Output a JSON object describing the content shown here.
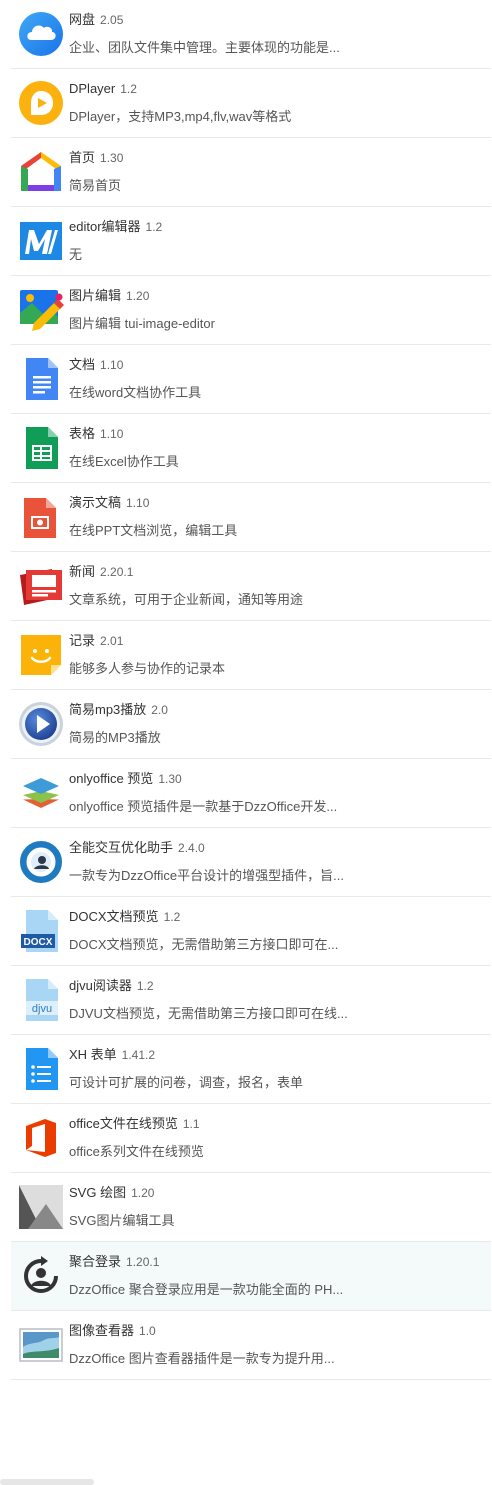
{
  "apps": [
    {
      "name": "网盘",
      "version": "2.05",
      "desc": "企业、团队文件集中管理。主要体现的功能是...",
      "icon": "cloud-icon"
    },
    {
      "name": "DPlayer",
      "version": "1.2",
      "desc": "DPlayer，支持MP3,mp4,flv,wav等格式",
      "icon": "dplayer-icon"
    },
    {
      "name": "首页",
      "version": "1.30",
      "desc": "简易首页",
      "icon": "home-icon"
    },
    {
      "name": "editor编辑器",
      "version": "1.2",
      "desc": "无",
      "icon": "editor-icon"
    },
    {
      "name": "图片编辑",
      "version": "1.20",
      "desc": "图片编辑 tui-image-editor",
      "icon": "image-edit-icon"
    },
    {
      "name": "文档",
      "version": "1.10",
      "desc": "在线word文档协作工具",
      "icon": "document-icon"
    },
    {
      "name": "表格",
      "version": "1.10",
      "desc": "在线Excel协作工具",
      "icon": "spreadsheet-icon"
    },
    {
      "name": "演示文稿",
      "version": "1.10",
      "desc": "在线PPT文档浏览，编辑工具",
      "icon": "presentation-icon"
    },
    {
      "name": "新闻",
      "version": "2.20.1",
      "desc": "文章系统，可用于企业新闻，通知等用途",
      "icon": "news-icon"
    },
    {
      "name": "记录",
      "version": "2.01",
      "desc": "能够多人参与协作的记录本",
      "icon": "notes-icon"
    },
    {
      "name": "简易mp3播放",
      "version": "2.0",
      "desc": "简易的MP3播放",
      "icon": "play-icon"
    },
    {
      "name": "onlyoffice 预览",
      "version": "1.30",
      "desc": "onlyoffice 预览插件是一款基于DzzOffice开发...",
      "icon": "onlyoffice-icon"
    },
    {
      "name": "全能交互优化助手",
      "version": "2.4.0",
      "desc": "一款专为DzzOffice平台设计的增强型插件，旨...",
      "icon": "assistant-icon"
    },
    {
      "name": "DOCX文档预览",
      "version": "1.2",
      "desc": "DOCX文档预览，无需借助第三方接口即可在...",
      "icon": "docx-icon",
      "icon_text": "DOCX"
    },
    {
      "name": "djvu阅读器",
      "version": "1.2",
      "desc": "DJVU文档预览，无需借助第三方接口即可在线...",
      "icon": "djvu-icon",
      "icon_text": "djvu"
    },
    {
      "name": "XH 表单",
      "version": "1.41.2",
      "desc": "可设计可扩展的问卷，调查，报名，表单",
      "icon": "form-icon"
    },
    {
      "name": "office文件在线预览",
      "version": "1.1",
      "desc": "office系列文件在线预览",
      "icon": "office-icon"
    },
    {
      "name": "SVG 绘图",
      "version": "1.20",
      "desc": "SVG图片编辑工具",
      "icon": "svg-draw-icon"
    },
    {
      "name": "聚合登录",
      "version": "1.20.1",
      "desc": "DzzOffice 聚合登录应用是一款功能全面的 PH...",
      "icon": "login-icon"
    },
    {
      "name": "图像查看器",
      "version": "1.0",
      "desc": "DzzOffice 图片查看器插件是一款专为提升用...",
      "icon": "image-viewer-icon"
    }
  ],
  "hovered_index": 18
}
